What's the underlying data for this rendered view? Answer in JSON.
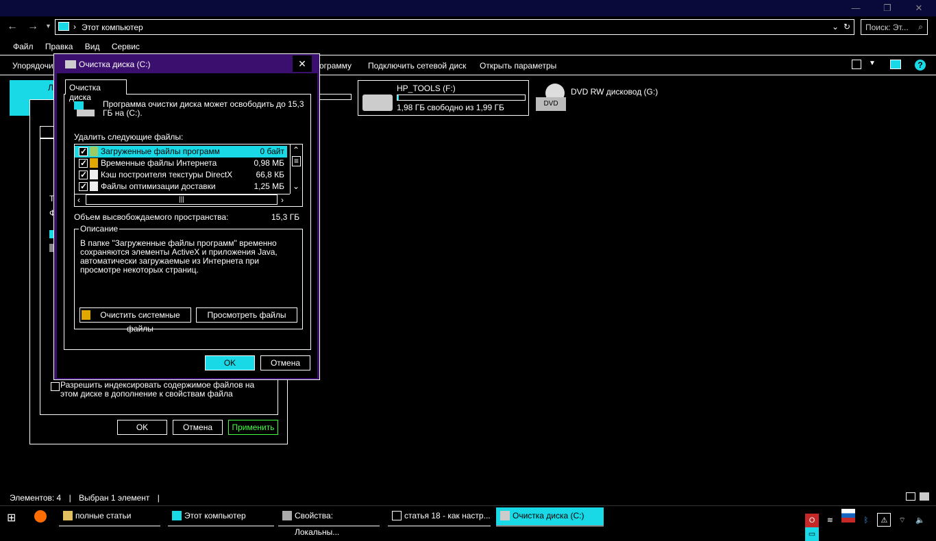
{
  "explorer": {
    "breadcrumb": "Этот компьютер",
    "search_placeholder": "Поиск: Эт...",
    "menu": [
      "Файл",
      "Правка",
      "Вид",
      "Сервис"
    ],
    "ribbon_left": "Упорядочит",
    "ribbon_partial": "ограмму",
    "ribbon_items": [
      "Подключить сетевой диск",
      "Открыть параметры"
    ],
    "drives": [
      {
        "name": "HP_TOOLS (F:)",
        "free": "1,98 ГБ свободно из 1,99 ГБ",
        "fill": 0.01
      },
      {
        "name": "DVD RW дисковод (G:)",
        "badge": "DVD"
      }
    ],
    "selected_drive_label": "Л",
    "status_items": "Элементов: 4",
    "status_selected": "Выбран 1 элемент"
  },
  "properties_dialog": {
    "index_checkbox": "Разрешить индексировать содержимое файлов на этом диске в дополнение к свойствам файла",
    "ok": "OK",
    "cancel": "Отмена",
    "apply": "Применить",
    "side_letters": [
      "Т",
      "Ф"
    ]
  },
  "cleanup_dialog": {
    "title": "Очистка диска  (C:)",
    "tab": "Очистка диска",
    "intro": "Программа очистки диска может освободить до 15,3 ГБ на  (C:).",
    "list_label": "Удалить следующие файлы:",
    "files": [
      {
        "name": "Загруженные файлы программ",
        "size": "0 байт"
      },
      {
        "name": "Временные файлы Интернета",
        "size": "0,98 МБ"
      },
      {
        "name": "Кэш построителя текстуры DirectX",
        "size": "66,8 КБ"
      },
      {
        "name": "Файлы оптимизации доставки",
        "size": "1,25 МБ"
      }
    ],
    "total_label": "Объем высвобождаемого пространства:",
    "total_value": "15,3 ГБ",
    "desc_legend": "Описание",
    "desc_text": "В папке \"Загруженные файлы программ\" временно сохраняются элементы ActiveX и приложения Java, автоматически загружаемые из Интернета при просмотре некоторых страниц.",
    "clean_system": "Очистить системные файлы",
    "view_files": "Просмотреть файлы",
    "ok": "OK",
    "cancel": "Отмена",
    "close": "✕"
  },
  "taskbar": {
    "items": [
      "полные статьи",
      "Этот компьютер",
      "Свойства: Локальны...",
      "статья 18 - как настр...",
      "Очистка диска  (C:)"
    ]
  },
  "colors": {
    "accent": "#1ad9e6",
    "dialog_frame": "#3b0f6e",
    "apply_green": "#3fff3f"
  }
}
